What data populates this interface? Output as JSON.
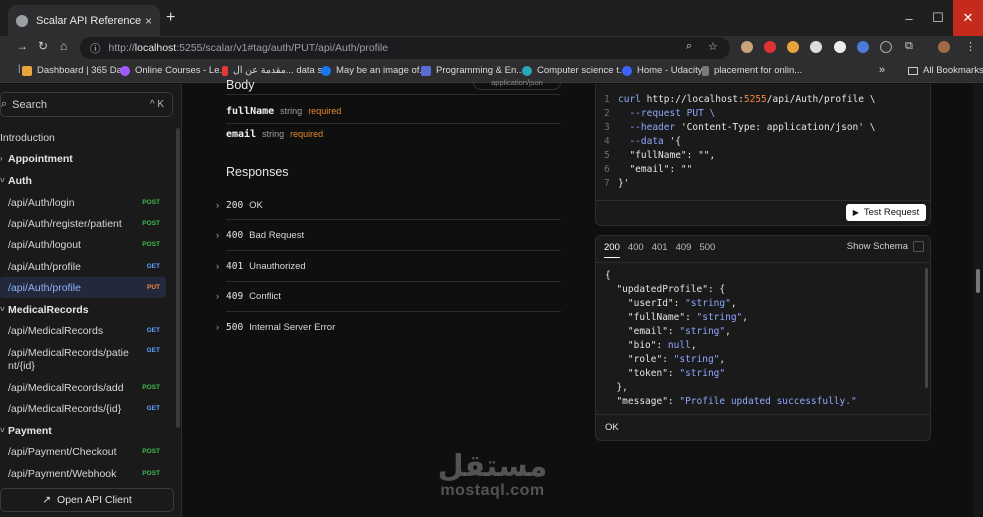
{
  "browser": {
    "tab_title": "Scalar API Reference",
    "tab_close": "×",
    "new_tab": "+",
    "url_prefix": "http://",
    "url_host": "localhost",
    "url_rest": ":5255/scalar/v1#tag/auth/PUT/api/Auth/profile",
    "window_controls": [
      "–",
      "☐",
      "✕"
    ]
  },
  "bookmarks": [
    {
      "label": "Dashboard | 365 Da...",
      "color": "#e8a33d"
    },
    {
      "label": "Online Courses - Le...",
      "color": "#a259ff"
    },
    {
      "label": "مقدمة عن ال... data str",
      "color": "#e53935"
    },
    {
      "label": "May be an image of...",
      "color": "#1877f2"
    },
    {
      "label": "Programming & En...",
      "color": "#5b6bd6"
    },
    {
      "label": "Computer science t...",
      "color": "#2aa6b8"
    },
    {
      "label": "Home - Udacity",
      "color": "#3d63ff"
    },
    {
      "label": "placement for onlin...",
      "color": "#7a7a7a"
    }
  ],
  "bookmarks_more": "»",
  "all_bookmarks": "All Bookmarks",
  "sidebar": {
    "search_placeholder": "Search",
    "search_shortcut": "^ K",
    "items": [
      {
        "label": "Introduction",
        "type": "link"
      },
      {
        "label": "Appointment",
        "type": "group"
      },
      {
        "label": "Auth",
        "type": "group"
      },
      {
        "label": "/api/Auth/login",
        "method": "POST"
      },
      {
        "label": "/api/Auth/register/patient",
        "method": "POST"
      },
      {
        "label": "/api/Auth/logout",
        "method": "POST"
      },
      {
        "label": "/api/Auth/profile",
        "method": "GET"
      },
      {
        "label": "/api/Auth/profile",
        "method": "PUT",
        "active": true
      },
      {
        "label": "MedicalRecords",
        "type": "group"
      },
      {
        "label": "/api/MedicalRecords",
        "method": "GET"
      },
      {
        "label": "/api/MedicalRecords/patie",
        "label2": "nt/{id}",
        "method": "GET"
      },
      {
        "label": "/api/MedicalRecords/add",
        "method": "POST"
      },
      {
        "label": "/api/MedicalRecords/{id}",
        "method": "GET"
      },
      {
        "label": "Payment",
        "type": "group"
      },
      {
        "label": "/api/Payment/Checkout",
        "method": "POST"
      },
      {
        "label": "/api/Payment/Webhook",
        "method": "POST"
      }
    ],
    "open_api_client": "Open API Client"
  },
  "body": {
    "title": "Body",
    "content_type": "application/json",
    "params": [
      {
        "name": "fullName",
        "type": "string",
        "required": "required"
      },
      {
        "name": "email",
        "type": "string",
        "required": "required"
      }
    ]
  },
  "responses": {
    "title": "Responses",
    "items": [
      {
        "code": "200",
        "label": "OK"
      },
      {
        "code": "400",
        "label": "Bad Request"
      },
      {
        "code": "401",
        "label": "Unauthorized"
      },
      {
        "code": "409",
        "label": "Conflict"
      },
      {
        "code": "500",
        "label": "Internal Server Error"
      }
    ]
  },
  "curl": {
    "line1_cmd": "curl",
    "line1_pre": "http://localhost:",
    "line1_port": "5255",
    "line1_post": "/api/Auth/profile \\",
    "line2": "--request PUT \\",
    "line3_flag": "--header",
    "line3_val": "'Content-Type: application/json' \\",
    "line4_flag": "--data",
    "line4_val": "'{",
    "line5": "\"fullName\": \"\",",
    "line6": "\"email\": \"\"",
    "line7": "}'",
    "test_request": "Test Request"
  },
  "response_panel": {
    "tabs": [
      "200",
      "400",
      "401",
      "409",
      "500"
    ],
    "show_schema": "Show Schema",
    "json_lines": [
      {
        "text": "{"
      },
      {
        "text": "  \"updatedProfile\": {"
      },
      {
        "key": "    \"userId\": ",
        "val": "\"string\"",
        "tail": ","
      },
      {
        "key": "    \"fullName\": ",
        "val": "\"string\"",
        "tail": ","
      },
      {
        "key": "    \"email\": ",
        "val": "\"string\"",
        "tail": ","
      },
      {
        "key": "    \"bio\": ",
        "val": "null",
        "tail": ","
      },
      {
        "key": "    \"role\": ",
        "val": "\"string\"",
        "tail": ","
      },
      {
        "key": "    \"token\": ",
        "val": "\"string\"",
        "tail": ""
      },
      {
        "text": "  },"
      },
      {
        "key": "  \"message\": ",
        "val": "\"Profile updated successfully.\"",
        "tail": ""
      }
    ],
    "status_text": "OK"
  },
  "watermark": {
    "arabic": "مستقل",
    "latin": "mostaql.com"
  }
}
